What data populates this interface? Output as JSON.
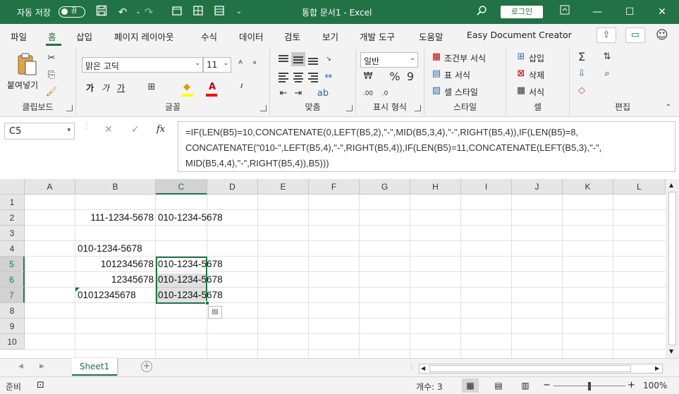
{
  "titlebar": {
    "autosave_label": "자동 저장",
    "toggle_state": "끔",
    "document_title": "통합 문서1  -  Excel",
    "login_label": "로그인"
  },
  "tabs": [
    "파일",
    "홈",
    "삽입",
    "페이지 레이아웃",
    "수식",
    "데이터",
    "검토",
    "보기",
    "개발 도구",
    "도움말",
    "Easy Document Creator"
  ],
  "ribbon": {
    "clipboard": {
      "paste_label": "붙여넣기",
      "group_label": "클립보드"
    },
    "font": {
      "font_name": "맑은 고딕",
      "font_size": "11",
      "group_label": "글꼴",
      "bold": "가",
      "italic": "가",
      "underline": "가"
    },
    "alignment": {
      "group_label": "맞춤"
    },
    "number": {
      "format": "일반",
      "group_label": "표시 형식"
    },
    "styles": {
      "conditional": "조건부 서식",
      "table": "표 서식",
      "cell": "셀 스타일",
      "group_label": "스타일"
    },
    "cells": {
      "insert": "삽입",
      "delete": "삭제",
      "format": "서식",
      "group_label": "셀"
    },
    "editing": {
      "group_label": "편집"
    }
  },
  "formula_bar": {
    "name_box": "C5",
    "fx": "fx",
    "formula_lines": [
      "=IF(LEN(B5)=10,CONCATENATE(0,LEFT(B5,2),\"-\",MID(B5,3,4),\"-\",RIGHT(B5,4)),IF(LEN(B5)=8,",
      "CONCATENATE(\"010-\",LEFT(B5,4),\"-\",RIGHT(B5,4)),IF(LEN(B5)=11,CONCATENATE(LEFT(B5,3),\"-\",",
      "MID(B5,4,4),\"-\",RIGHT(B5,4)),B5)))"
    ]
  },
  "grid": {
    "columns": [
      "A",
      "B",
      "C",
      "D",
      "E",
      "F",
      "G",
      "H",
      "I",
      "J",
      "K",
      "L"
    ],
    "rows": [
      "1",
      "2",
      "3",
      "4",
      "5",
      "6",
      "7",
      "8",
      "9",
      "10"
    ],
    "cells": {
      "B2": "111-1234-5678",
      "C2": "010-1234-5678",
      "B4": "010-1234-5678",
      "B5": "1012345678",
      "C5": "010-1234-5678",
      "B6": "12345678",
      "C6": "010-1234-5678",
      "B7": "01012345678",
      "C7": "010-1234-5678"
    }
  },
  "sheets": {
    "active": "Sheet1"
  },
  "status": {
    "ready": "준비",
    "count": "개수: 3",
    "zoom": "100%"
  },
  "colors": {
    "brand": "#217346"
  }
}
